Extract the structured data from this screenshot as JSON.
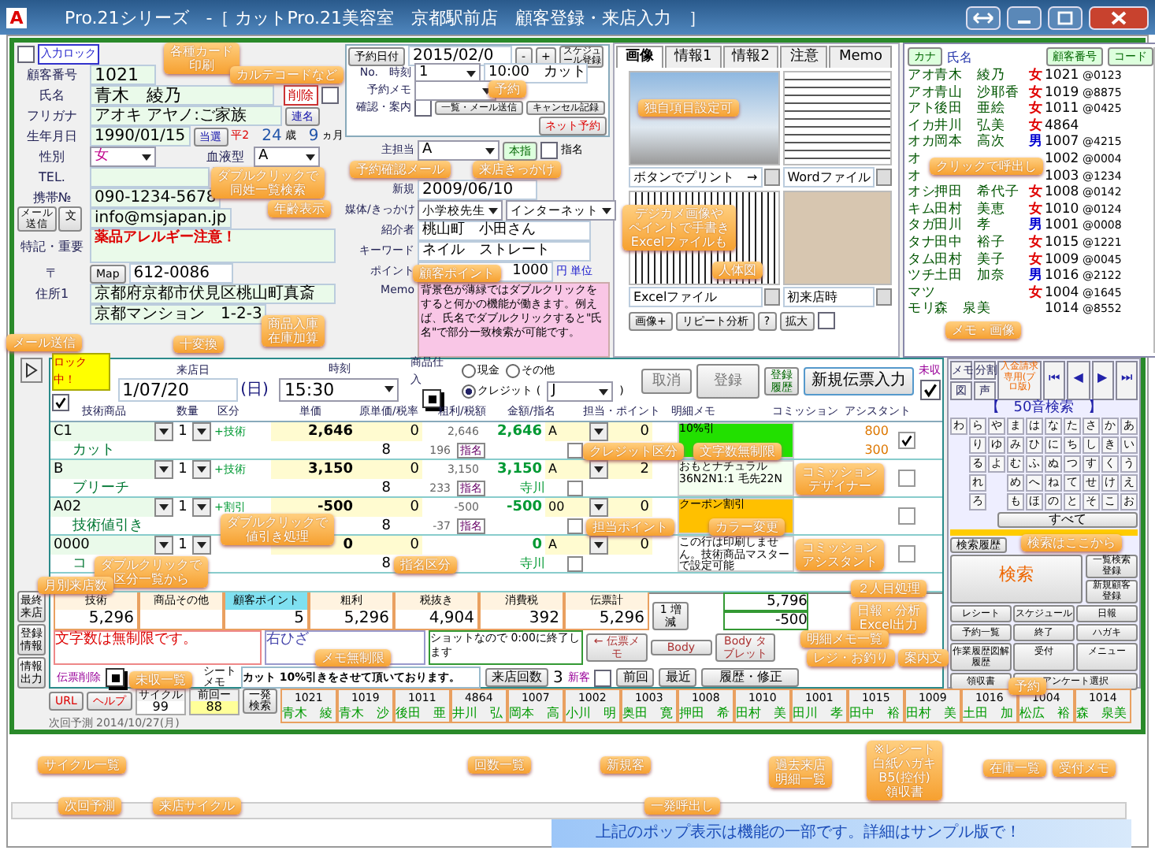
{
  "window": {
    "title": "Pro.21シリーズ　-［ カットPro.21美容室　京都駅前店　顧客登録・来店入力　］",
    "app_icon": "A"
  },
  "customer": {
    "input_lock": {
      "label": "入力ロック",
      "checked": false
    },
    "number": {
      "label": "顧客番号",
      "value": "1021"
    },
    "name": {
      "label": "氏名",
      "value": "青木　綾乃",
      "delete_label": "削除",
      "delete_checked": false
    },
    "kana": {
      "label": "フリガナ",
      "value": "アオキ アヤノ:ご家族",
      "button": "連名"
    },
    "birth": {
      "label": "生年月日",
      "value": "1990/01/15",
      "button": "当選",
      "era": "平2",
      "age": "24",
      "age_unit": "歳",
      "months": "9",
      "months_unit": "ヵ月"
    },
    "sex": {
      "label": "性別",
      "value": "女",
      "blood_label": "血液型",
      "blood": "A"
    },
    "tel": {
      "label": "TEL."
    },
    "mobile": {
      "label": "携帯№",
      "value": "090-1234-5678"
    },
    "mail": {
      "send_button": "メール送信",
      "text_button": "文",
      "value": "info@msjapan.jp"
    },
    "note": {
      "label": "特記・重要",
      "value": "薬品アレルギー注意！"
    },
    "zip": {
      "label": "〒",
      "map_button": "Map",
      "value": "612-0086"
    },
    "address": {
      "label": "住所1",
      "line1": "京都府京都市伏見区桃山町真斎",
      "line2": "京都マンション　1-2-3"
    }
  },
  "reservation": {
    "date_button": "予約日付",
    "date": "2015/02/0",
    "minus": "-",
    "plus": "+",
    "schedule_button": "スケジュール登録",
    "no_label": "No.　時刻",
    "no": "1",
    "time_text": "10:00　カット",
    "memo_label": "予約メモ",
    "confirm_label": "確認・案内",
    "confirm_checked": false,
    "mail_button": "一覧・メール送信",
    "cancel_button": "キャンセル記録",
    "net_button": "ネット予約"
  },
  "details": {
    "staff_label": "主担当",
    "staff": "A",
    "honshi": "本指",
    "shimei_checked": false,
    "shimei": "指名",
    "new_label": "新規",
    "new_date": "2009/06/10",
    "media_label": "媒体/きっかけ",
    "media": "小学校先生",
    "media2": "インターネット",
    "intro_label": "紹介者",
    "intro": "桃山町　小田さん",
    "keyword_label": "キーワード",
    "keyword": "ネイル　ストレート",
    "point_label": "ポイント",
    "point": "1000",
    "point_unit": "円 単位",
    "memo_label": "Memo",
    "memo": "背景色が薄緑ではダブルクリックをすると何かの機能が働きます。例えば、氏名でダブルクリックすると\"氏名\"で部分一致検索が可能です。"
  },
  "image_tabs": {
    "tabs": [
      {
        "label": "画像",
        "selected": true
      },
      {
        "label": "情報1",
        "selected": false
      },
      {
        "label": "情報2",
        "selected": false
      },
      {
        "label": "注意",
        "selected": false
      },
      {
        "label": "Memo",
        "selected": false
      }
    ],
    "images": [
      {
        "kind": "photo",
        "caption": "ボタンでプリント　→"
      },
      {
        "kind": "document",
        "caption": "Wordファイル"
      },
      {
        "kind": "sheet",
        "caption": "Excelファイル"
      },
      {
        "kind": "portrait",
        "caption": "初来店時"
      }
    ],
    "buttons": [
      "画像+",
      "リピート分析",
      "?",
      "拡大"
    ],
    "check": false
  },
  "customer_list": {
    "headers": {
      "kana": "カナ",
      "name": "氏名",
      "number": "顧客番号",
      "code": "コード"
    },
    "rows": [
      {
        "kana": "アオ",
        "name": "青木　綾乃",
        "sex": "女",
        "color": "#e00000",
        "number": "1021",
        "code": "@0123"
      },
      {
        "kana": "アオ",
        "name": "青山　沙耶香",
        "sex": "女",
        "color": "#e00000",
        "number": "1019",
        "code": "@8875"
      },
      {
        "kana": "アト",
        "name": "後田　亜絵",
        "sex": "女",
        "color": "#e00000",
        "number": "1011",
        "code": "@0425"
      },
      {
        "kana": "イカ",
        "name": "井川　弘美",
        "sex": "女",
        "color": "#e00000",
        "number": "4864"
      },
      {
        "kana": "オカ",
        "name": "岡本　高次",
        "sex": "男",
        "color": "#0000d0",
        "number": "1007",
        "code": "@4215"
      },
      {
        "kana": "オ",
        "number": "1002",
        "code": "@0004"
      },
      {
        "kana": "オ",
        "number": "1003",
        "code": "@1234"
      },
      {
        "kana": "オシ",
        "name": "押田　希代子",
        "sex": "女",
        "color": "#e00000",
        "number": "1008",
        "code": "@0142"
      },
      {
        "kana": "キム",
        "name": "田村　美恵",
        "sex": "女",
        "color": "#e00000",
        "number": "1010",
        "code": "@0124"
      },
      {
        "kana": "タガ",
        "name": "田川　孝",
        "sex": "男",
        "color": "#0000d0",
        "number": "1001",
        "code": "@0008"
      },
      {
        "kana": "タナ",
        "name": "田中　裕子",
        "sex": "女",
        "color": "#e00000",
        "number": "1015",
        "code": "@1221"
      },
      {
        "kana": "タム",
        "name": "田村　美子",
        "sex": "女",
        "color": "#e00000",
        "number": "1009",
        "code": "@0045"
      },
      {
        "kana": "ツチ",
        "name": "土田　加奈",
        "sex": "男",
        "color": "#0000d0",
        "number": "1016",
        "code": "@2122"
      },
      {
        "kana": "マツ",
        "sex": "女",
        "color": "#e00000",
        "number": "1004",
        "code": "@1645"
      },
      {
        "kana": "モリ",
        "name": "森　泉美",
        "number": "1014",
        "code": "@8552"
      }
    ]
  },
  "slip": {
    "lock": {
      "label": "ロック中！",
      "checked": true
    },
    "date_label": "来店日",
    "date": "1/07/20",
    "weekday": "(日)",
    "time_label": "時刻",
    "time": "15:30",
    "stock_label": "商品仕入",
    "stock_checked": true,
    "payments": [
      {
        "label": "現金",
        "selected": false
      },
      {
        "label": "その他",
        "selected": false
      },
      {
        "label": "クレジット (",
        "selected": true
      }
    ],
    "card": "J",
    "card_close": ")",
    "cancel": "取消",
    "register": "登録",
    "history": "登録履歴",
    "new_slip": "新規伝票入力",
    "unpaid": "未収",
    "unpaid_checked": true,
    "columns": [
      "技術商品",
      "数量",
      "区分",
      "単価",
      "原単価/税率",
      "粗利/税額",
      "金額/指名",
      "担当・ポイント",
      "明細メモ",
      "コミッション",
      "アシスタント"
    ],
    "rows": [
      {
        "code": "C1",
        "name": "カット",
        "qty": "1",
        "category": "+技術",
        "price": "2,646",
        "cost": "0",
        "rate": "8",
        "profit": "2,646",
        "tax": "196",
        "amount": "2,646",
        "staff": "A",
        "shimei": "指名",
        "point": "0",
        "memo": "10%引",
        "color": "#22e000",
        "commission": "800",
        "commission2": "300",
        "check": true,
        "flag": false
      },
      {
        "code": "B",
        "name": "ブリーチ",
        "qty": "1",
        "category": "+技術",
        "price": "3,150",
        "cost": "0",
        "rate": "8",
        "profit": "3,150",
        "tax": "233",
        "amount": "3,150",
        "staff": "A",
        "shimei": "指名",
        "assist": "寺川",
        "point": "2",
        "memo": "おもとナチュラル 36N2N1:1 毛先22N",
        "color": "#f4fff0",
        "check": false,
        "flag": false
      },
      {
        "code": "A02",
        "name": "技術値引き",
        "qty": "1",
        "category": "+割引",
        "price": "-500",
        "cost": "0",
        "rate": "8",
        "profit": "-500",
        "tax": "-37",
        "amount": "-500",
        "staff": "00",
        "shimei": "指名",
        "point": "0",
        "memo": "クーポン割引",
        "color": "#ffc000",
        "check": false,
        "flag": false
      },
      {
        "code": "0000",
        "name": "コ",
        "qty": "1",
        "price": "0",
        "cost": "0",
        "rate": "8",
        "amount": "0",
        "staff": "A",
        "assist": "寺川",
        "point": "0",
        "memo": "この行は印刷しません。技術商品マスターで設定可能",
        "color": "#ffffff",
        "check": false,
        "flag": false
      }
    ],
    "totals": [
      {
        "label": "技術",
        "value": "5,296"
      },
      {
        "label": "商品その他"
      },
      {
        "label": "顧客ポイント",
        "value": "5"
      },
      {
        "label": "粗利",
        "value": "5,296"
      },
      {
        "label": "税抜き",
        "value": "4,904"
      },
      {
        "label": "消費税",
        "value": "392"
      },
      {
        "label": "伝票計",
        "value": "5,296"
      }
    ],
    "slip_total": "5,796",
    "discount": "-500",
    "recount": "1 増減",
    "memo1": "文字数は無制限です。",
    "memo2": "右ひざ",
    "memo3": "ショットなので 0:00に終了します",
    "memo_buttons": [
      "← 伝票メモ",
      "Body",
      "Body タブレット"
    ],
    "delete_label": "伝票削除",
    "delete_checked": true,
    "sheet_memo_label": "シートメモ",
    "sheet_memo": "カット 10%引きをさせて頂いております。",
    "visits_button": "来店回数",
    "visits": "3",
    "new_customer": "新客",
    "new_customer_checked": false,
    "prev": "前回",
    "recent": "最近",
    "history_edit": "履歴・修正",
    "side_buttons": [
      "最終来店",
      "登録情報",
      "情報出力"
    ],
    "url": "URL",
    "help": "ヘルプ",
    "cycle_label": "サイクル",
    "cycle": "99",
    "prev_label": "前回ー",
    "prev_value": "88",
    "quick_search": "一発検索",
    "next_label": "次回予測",
    "next": "2014/10/27(月)",
    "visits_history": [
      {
        "number": "1021",
        "name": "青木　綾"
      },
      {
        "number": "1019",
        "name": "青木　沙"
      },
      {
        "number": "1011",
        "name": "後田　亜"
      },
      {
        "number": "4864",
        "name": "井川　弘"
      },
      {
        "number": "1007",
        "name": "岡本　高"
      },
      {
        "number": "1002",
        "name": "小川　明"
      },
      {
        "number": "1003",
        "name": "奥田　寛"
      },
      {
        "number": "1008",
        "name": "押田　希"
      },
      {
        "number": "1010",
        "name": "田村　美"
      },
      {
        "number": "1001",
        "name": "田川　孝"
      },
      {
        "number": "1015",
        "name": "田中　裕"
      },
      {
        "number": "1009",
        "name": "田村　美"
      },
      {
        "number": "1016",
        "name": "土田　加"
      },
      {
        "number": "1004",
        "name": "松広　裕"
      },
      {
        "number": "1014",
        "name": "森　泉美"
      }
    ]
  },
  "search_panel": {
    "nav_buttons": [
      {
        "label": "メモ",
        "kind": "text"
      },
      {
        "label": "分割",
        "kind": "text"
      },
      {
        "label": "入金請求専用(プロ版)",
        "kind": "accent"
      },
      {
        "label": "⏮",
        "kind": "nav"
      },
      {
        "label": "◀",
        "kind": "nav"
      },
      {
        "label": "▶",
        "kind": "nav"
      },
      {
        "label": "⏭",
        "kind": "nav"
      },
      {
        "label": "図",
        "kind": "text"
      },
      {
        "label": "声",
        "kind": "text"
      }
    ],
    "title": "【　50音検索　】",
    "kana_rows": [
      [
        "わ",
        "ら",
        "や",
        "ま",
        "は",
        "な",
        "た",
        "さ",
        "か",
        "あ"
      ],
      [
        "",
        "り",
        "ゆ",
        "み",
        "ひ",
        "に",
        "ち",
        "し",
        "き",
        "い"
      ],
      [
        "",
        "る",
        "よ",
        "む",
        "ふ",
        "ぬ",
        "つ",
        "す",
        "く",
        "う"
      ],
      [
        "",
        "れ",
        "",
        "め",
        "へ",
        "ね",
        "て",
        "せ",
        "け",
        "え"
      ],
      [
        "",
        "ろ",
        "",
        "も",
        "ほ",
        "の",
        "と",
        "そ",
        "こ",
        "お"
      ]
    ],
    "all": "すべて",
    "history": "検索履歴",
    "search": "検索",
    "list_register": "一覧検索登録",
    "new_register": "新規顧客登録",
    "bottom_buttons": [
      "レシート",
      "スケジュール",
      "日報",
      "予約一覧",
      "終了",
      "ハガキ",
      "作業履歴図解履歴",
      "受付",
      "メニュー",
      "領収書",
      "アンケート選択"
    ]
  },
  "callouts": [
    [
      "各種カード",
      "印刷"
    ],
    [
      "カルテコードなど"
    ],
    [
      "予約"
    ],
    [
      "ダブルクリックで",
      "同姓一覧検索"
    ],
    [
      "予約確認メール"
    ],
    [
      "来店きっかけ"
    ],
    [
      "年齢表示"
    ],
    [
      "顧客ポイント"
    ],
    [
      "独自項目設定可"
    ],
    [
      "クリックで呼出し"
    ],
    [
      "デジカメ画像や",
      "ペイントで手書き",
      "Excelファイルも"
    ],
    [
      "メール送信"
    ],
    [
      "商品入庫",
      "在庫加算"
    ],
    [
      "メモ・画像"
    ],
    [
      "人体図"
    ],
    [
      "十変換"
    ],
    [
      "クレジット区分"
    ],
    [
      "文字数無制限"
    ],
    [
      "コミッション",
      "デザイナー"
    ],
    [
      "ダブルクリックで",
      "値引き処理"
    ],
    [
      "担当ポイント"
    ],
    [
      "カラー変更"
    ],
    [
      "ダブルクリックで",
      "区分一覧から"
    ],
    [
      "指名区分"
    ],
    [
      "コミッション",
      "アシスタント"
    ],
    [
      "検索はここから"
    ],
    [
      "月別来店数"
    ],
    [
      "２人目処理"
    ],
    [
      "日報・分析",
      "Excel出力"
    ],
    [
      "明細メモ一覧"
    ],
    [
      "メモ無制限"
    ],
    [
      "レジ・お釣り"
    ],
    [
      "案内文"
    ],
    [
      "未収一覧"
    ],
    [
      "予約"
    ],
    [
      "サイクル一覧"
    ],
    [
      "回数一覧"
    ],
    [
      "新規客"
    ],
    [
      "過去来店",
      "明細一覧"
    ],
    [
      "※レシート",
      "白紙ハガキ",
      "B5(控付)",
      "領収書"
    ],
    [
      "在庫一覧"
    ],
    [
      "受付メモ"
    ],
    [
      "次回予測"
    ],
    [
      "来店サイクル"
    ],
    [
      "一発呼出し"
    ]
  ],
  "banner": "上記のポップ表示は機能の一部です。詳細はサンプル版で！"
}
